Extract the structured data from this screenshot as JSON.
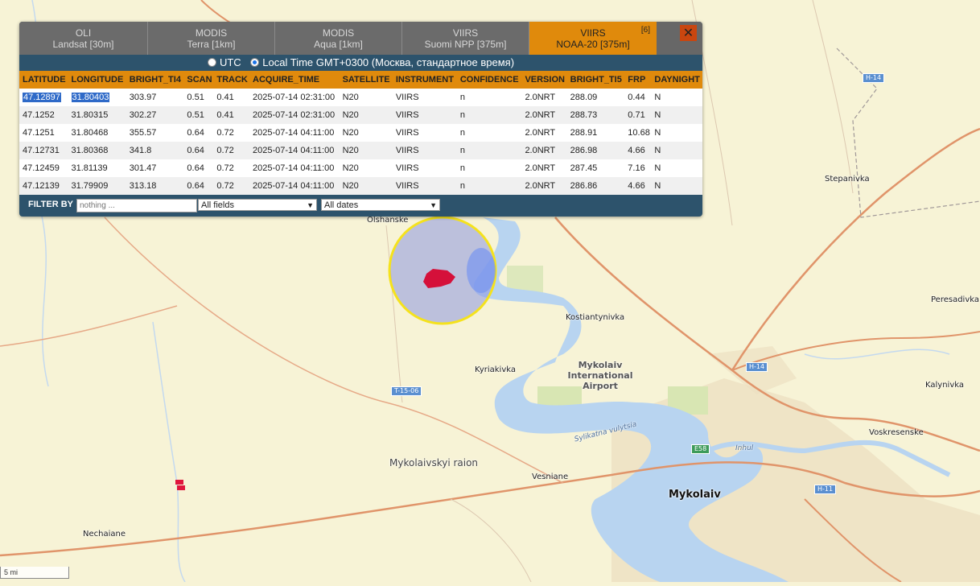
{
  "tabs": [
    {
      "line1": "OLI",
      "line2": "Landsat [30m]",
      "active": false
    },
    {
      "line1": "MODIS",
      "line2": "Terra [1km]",
      "active": false
    },
    {
      "line1": "MODIS",
      "line2": "Aqua [1km]",
      "active": false
    },
    {
      "line1": "VIIRS",
      "line2": "Suomi NPP [375m]",
      "active": false
    },
    {
      "line1": "VIIRS",
      "line2": "NOAA-20 [375m]",
      "active": true,
      "badge": "[6]"
    }
  ],
  "close_label": "✕",
  "timezone": {
    "utc_label": "UTC",
    "local_label": "Local Time GMT+0300 (Москва, стандартное время)",
    "selected": "local"
  },
  "table": {
    "columns": [
      "LATITUDE",
      "LONGITUDE",
      "BRIGHT_TI4",
      "SCAN",
      "TRACK",
      "ACQUIRE_TIME",
      "SATELLITE",
      "INSTRUMENT",
      "CONFIDENCE",
      "VERSION",
      "BRIGHT_TI5",
      "FRP",
      "DAYNIGHT"
    ],
    "rows": [
      [
        "47.12897",
        "31.80403",
        "303.97",
        "0.51",
        "0.41",
        "2025-07-14 02:31:00",
        "N20",
        "VIIRS",
        "n",
        "2.0NRT",
        "288.09",
        "0.44",
        "N"
      ],
      [
        "47.1252",
        "31.80315",
        "302.27",
        "0.51",
        "0.41",
        "2025-07-14 02:31:00",
        "N20",
        "VIIRS",
        "n",
        "2.0NRT",
        "288.73",
        "0.71",
        "N"
      ],
      [
        "47.1251",
        "31.80468",
        "355.57",
        "0.64",
        "0.72",
        "2025-07-14 04:11:00",
        "N20",
        "VIIRS",
        "n",
        "2.0NRT",
        "288.91",
        "10.68",
        "N"
      ],
      [
        "47.12731",
        "31.80368",
        "341.8",
        "0.64",
        "0.72",
        "2025-07-14 04:11:00",
        "N20",
        "VIIRS",
        "n",
        "2.0NRT",
        "286.98",
        "4.66",
        "N"
      ],
      [
        "47.12459",
        "31.81139",
        "301.47",
        "0.64",
        "0.72",
        "2025-07-14 04:11:00",
        "N20",
        "VIIRS",
        "n",
        "2.0NRT",
        "287.45",
        "7.16",
        "N"
      ],
      [
        "47.12139",
        "31.79909",
        "313.18",
        "0.64",
        "0.72",
        "2025-07-14 04:11:00",
        "N20",
        "VIIRS",
        "n",
        "2.0NRT",
        "286.86",
        "4.66",
        "N"
      ]
    ]
  },
  "filter": {
    "label": "FILTER BY",
    "placeholder": "nothing ...",
    "field_select": "All fields",
    "date_select": "All dates"
  },
  "map": {
    "places": {
      "olshanske": "Olshanske",
      "stepanivka": "Stepanivka",
      "peresadivka": "Peresadivka",
      "kostiantynivka": "Kostiantynivka",
      "kyriakivka": "Kyriakivka",
      "airport_line1": "Mykolaiv",
      "airport_line2": "International",
      "airport_line3": "Airport",
      "kalynivka": "Kalynivka",
      "voskresenske": "Voskresenske",
      "raion": "Mykolaivskyi raion",
      "vesniane": "Vesniane",
      "mykolaiv": "Mykolaiv",
      "nechaiane": "Nechaiane",
      "inhul": "Inhul",
      "street": "Sylikatna vulytsia"
    },
    "shields": {
      "h14a": "H-14",
      "h14b": "H-14",
      "t1506": "T-15-06",
      "e58": "E58",
      "h11": "H-11"
    },
    "scale": "5 mi",
    "colors": {
      "land": "#f7f3d6",
      "water": "#b8d4f0",
      "urban": "#ece0c2",
      "road_major": "#e0946a",
      "fire": "#e0163c",
      "highlight_ring": "#f5e21c"
    }
  }
}
